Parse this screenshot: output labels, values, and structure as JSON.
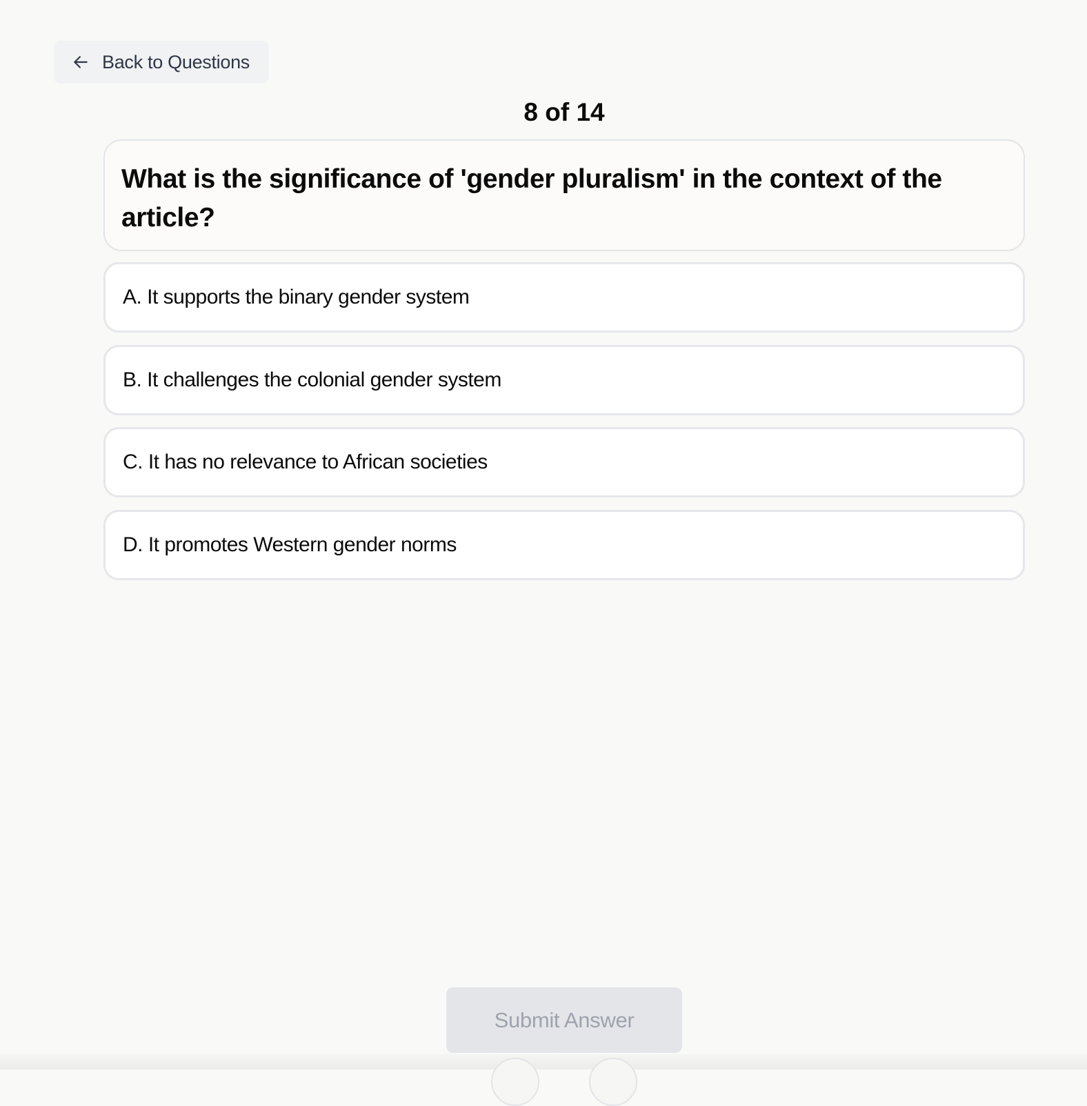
{
  "header": {
    "back_label": "Back to Questions",
    "back_icon": "arrow-left-icon"
  },
  "progress": {
    "text": "8 of 14",
    "current": 8,
    "total": 14
  },
  "question": {
    "text": "What is the significance of 'gender pluralism' in the context of the article?"
  },
  "options": [
    {
      "label": "A. It supports the binary gender system"
    },
    {
      "label": "B. It challenges the colonial gender system"
    },
    {
      "label": "C. It has no relevance to African societies"
    },
    {
      "label": "D. It promotes Western gender norms"
    }
  ],
  "footer": {
    "submit_label": "Submit Answer",
    "submit_enabled": false
  },
  "colors": {
    "background": "#f9f9f7",
    "card_border": "#e3e4e8",
    "submit_disabled_bg": "#e4e5e9",
    "submit_disabled_text": "#9ea3ad",
    "back_button_bg": "#f1f2f4"
  }
}
